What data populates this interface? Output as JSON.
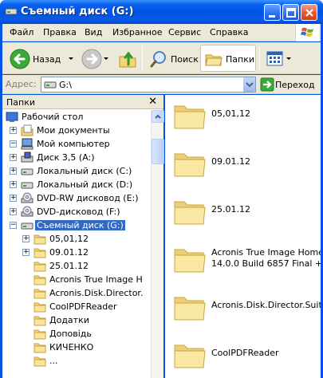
{
  "window": {
    "title": "Съемный диск (G:)"
  },
  "menu": [
    "Файл",
    "Правка",
    "Вид",
    "Избранное",
    "Сервис",
    "Справка"
  ],
  "toolbar": {
    "back_label": "Назад",
    "search_label": "Поиск",
    "folders_label": "Папки"
  },
  "address": {
    "label": "Адрес:",
    "value": "G:\\",
    "go_label": "Переход"
  },
  "folder_pane": {
    "title": "Папки",
    "tree": [
      {
        "label": "Рабочий стол",
        "level": 0,
        "expander": "",
        "icon": "desktop-icon"
      },
      {
        "label": "Мои документы",
        "level": 1,
        "expander": "+",
        "icon": "my-documents-icon"
      },
      {
        "label": "Мой компьютер",
        "level": 1,
        "expander": "−",
        "icon": "my-computer-icon"
      },
      {
        "label": "Диск 3,5 (A:)",
        "level": 2,
        "expander": "+",
        "icon": "floppy-drive-icon"
      },
      {
        "label": "Локальный диск (C:)",
        "level": 2,
        "expander": "+",
        "icon": "hard-drive-icon"
      },
      {
        "label": "Локальный диск (D:)",
        "level": 2,
        "expander": "+",
        "icon": "hard-drive-icon"
      },
      {
        "label": "DVD-RW дисковод (E:)",
        "level": 2,
        "expander": "+",
        "icon": "dvd-drive-icon"
      },
      {
        "label": "DVD-дисковод (F:)",
        "level": 2,
        "expander": "+",
        "icon": "dvd-drive-icon"
      },
      {
        "label": "Съемный диск (G:)",
        "level": 2,
        "expander": "−",
        "icon": "removable-drive-icon",
        "selected": true
      },
      {
        "label": "05,01,12",
        "level": 3,
        "expander": "+",
        "icon": "folder-icon"
      },
      {
        "label": "09.01.12",
        "level": 3,
        "expander": "+",
        "icon": "folder-icon"
      },
      {
        "label": "25.01.12",
        "level": 3,
        "expander": "",
        "icon": "folder-icon"
      },
      {
        "label": "Acronis True Image H",
        "level": 3,
        "expander": "",
        "icon": "folder-icon"
      },
      {
        "label": "Acronis.Disk.Director.",
        "level": 3,
        "expander": "",
        "icon": "folder-icon"
      },
      {
        "label": "CoolPDFReader",
        "level": 3,
        "expander": "",
        "icon": "folder-icon"
      },
      {
        "label": "Додатки",
        "level": 3,
        "expander": "",
        "icon": "folder-icon"
      },
      {
        "label": "Доповідь",
        "level": 3,
        "expander": "",
        "icon": "folder-icon"
      },
      {
        "label": "КИЧЕНКО",
        "level": 3,
        "expander": "",
        "icon": "folder-icon"
      },
      {
        "label": "...",
        "level": 3,
        "expander": "",
        "icon": "folder-icon"
      }
    ]
  },
  "content": {
    "items": [
      {
        "name": "05,01,12",
        "icon": "folder-icon"
      },
      {
        "name": "09.01.12",
        "icon": "folder-icon"
      },
      {
        "name": "25.01.12",
        "icon": "folder-icon"
      },
      {
        "name": "Acronis True Image Home\n14.0.0 Build 6857 Final +",
        "icon": "folder-icon"
      },
      {
        "name": "Acronis.Disk.Director.Suite",
        "icon": "folder-icon"
      },
      {
        "name": "CoolPDFReader",
        "icon": "folder-icon"
      }
    ]
  }
}
